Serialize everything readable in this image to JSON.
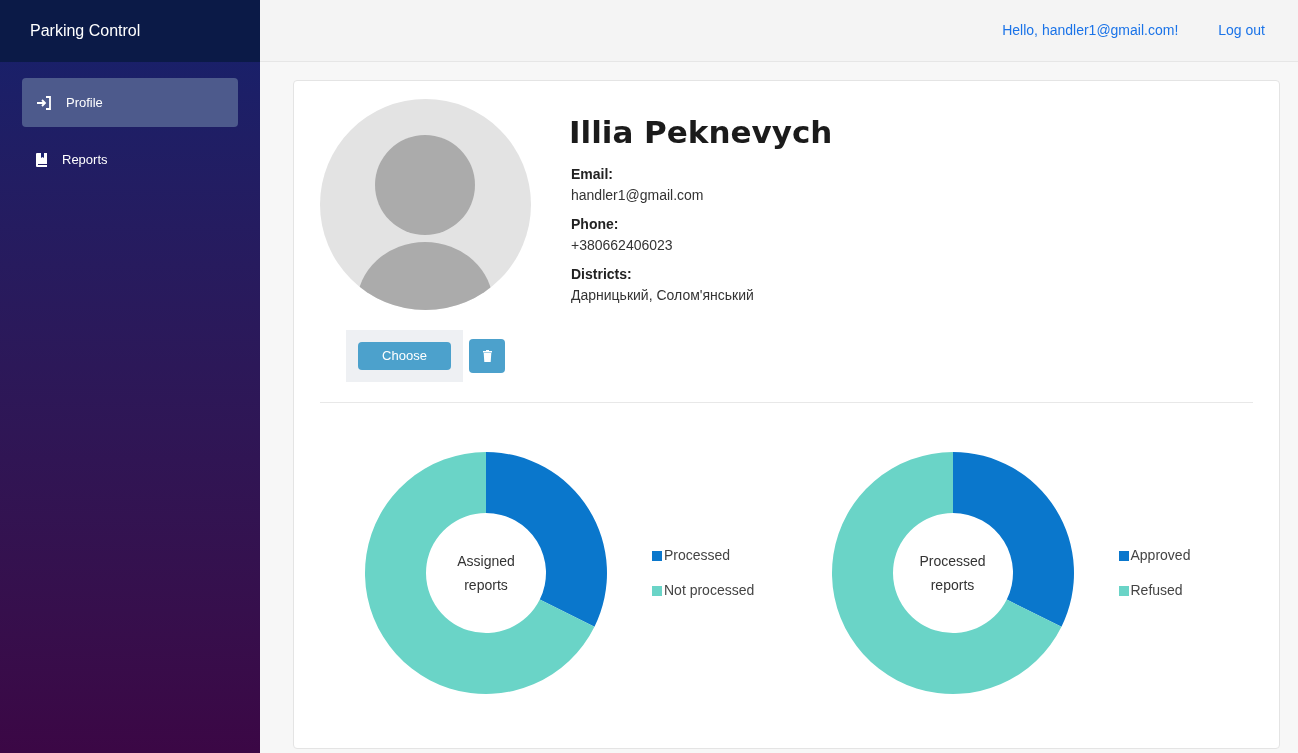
{
  "sidebar": {
    "title": "Parking Control",
    "items": [
      {
        "label": "Profile",
        "selected": true
      },
      {
        "label": "Reports",
        "selected": false
      }
    ]
  },
  "header": {
    "greeting": "Hello, handler1@gmail.com!",
    "logout": "Log out"
  },
  "profile": {
    "name": "Illia Peknevych",
    "fields": [
      {
        "label": "Email:",
        "value": "handler1@gmail.com"
      },
      {
        "label": "Phone:",
        "value": "+380662406023"
      },
      {
        "label": "Districts:",
        "value": "Дарницький, Солом'янський"
      }
    ],
    "choose_button": "Choose"
  },
  "charts": [
    {
      "center_label": "Assigned reports",
      "legend": [
        {
          "label": "Processed",
          "color": "#0a77cc"
        },
        {
          "label": "Not processed",
          "color": "#6ad4c7"
        }
      ]
    },
    {
      "center_label": "Processed reports",
      "legend": [
        {
          "label": "Approved",
          "color": "#0a77cc"
        },
        {
          "label": "Refused",
          "color": "#6ad4c7"
        }
      ]
    }
  ]
}
